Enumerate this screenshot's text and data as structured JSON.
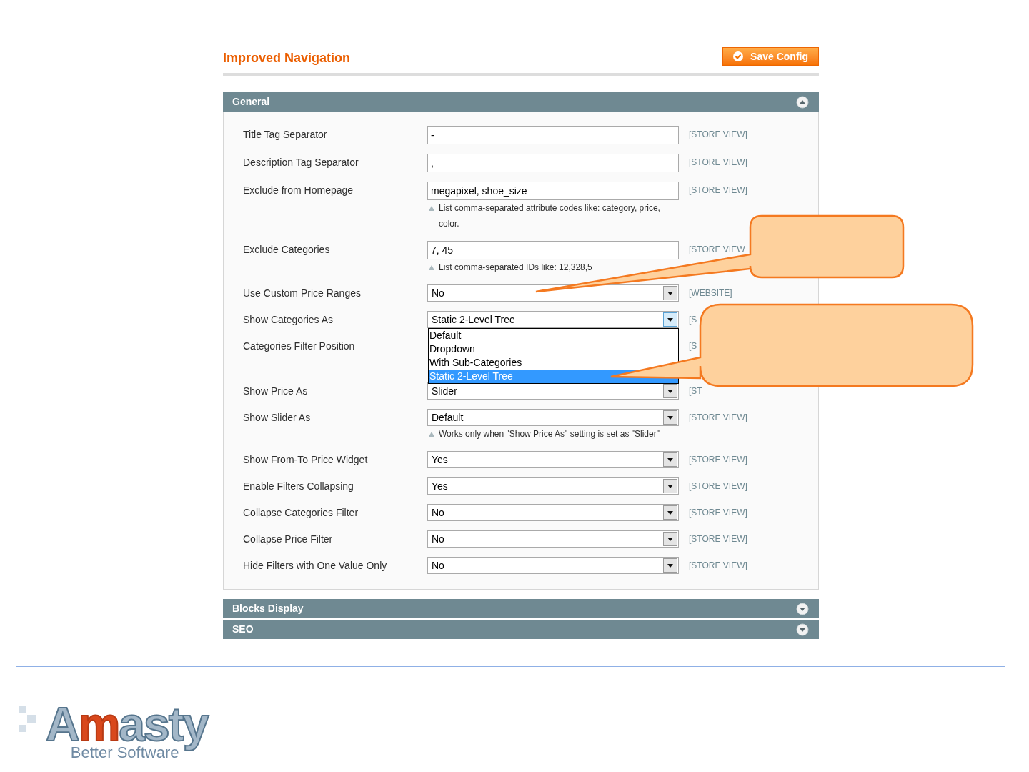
{
  "header": {
    "title": "Improved Navigation",
    "save_button": "Save Config"
  },
  "sections": [
    {
      "title": "General",
      "expanded": true,
      "rows": [
        {
          "kind": "text",
          "label": "Title Tag Separator",
          "value": "-",
          "scope": "[STORE VIEW]"
        },
        {
          "kind": "text",
          "label": "Description Tag Separator",
          "value": ",",
          "scope": "[STORE VIEW]"
        },
        {
          "kind": "text",
          "label": "Exclude from Homepage",
          "value": "megapixel, shoe_size",
          "scope": "[STORE VIEW]",
          "hint": "List comma-separated attribute codes like: category, price, color."
        },
        {
          "kind": "text",
          "label": "Exclude Categories",
          "value": "7, 45",
          "scope": "[STORE VIEW",
          "hint": "List comma-separated IDs like: 12,328,5"
        },
        {
          "kind": "select",
          "label": "Use Custom Price Ranges",
          "value": "No",
          "scope": "[WEBSITE]",
          "open": false
        },
        {
          "kind": "select",
          "label": "Show Categories As",
          "value": "Static 2-Level Tree",
          "scope": "[S",
          "open": true,
          "options": [
            {
              "label": "Default",
              "selected": false
            },
            {
              "label": "Dropdown",
              "selected": false
            },
            {
              "label": "With Sub-Categories",
              "selected": false
            },
            {
              "label": "Static 2-Level Tree",
              "selected": true
            }
          ]
        },
        {
          "kind": "covered",
          "label": "Categories Filter Position",
          "scope": "[S"
        },
        {
          "kind": "select",
          "label": "Show Price As",
          "value": "Slider",
          "scope": "[ST",
          "open": false
        },
        {
          "kind": "select",
          "label": "Show Slider As",
          "value": "Default",
          "scope": "[STORE VIEW]",
          "open": false,
          "hint": "Works only when \"Show Price As\" setting is set as \"Slider\""
        },
        {
          "kind": "select",
          "label": "Show From-To Price Widget",
          "value": "Yes",
          "scope": "[STORE VIEW]",
          "open": false
        },
        {
          "kind": "select",
          "label": "Enable Filters Collapsing",
          "value": "Yes",
          "scope": "[STORE VIEW]",
          "open": false
        },
        {
          "kind": "select",
          "label": "Collapse Categories Filter",
          "value": "No",
          "scope": "[STORE VIEW]",
          "open": false
        },
        {
          "kind": "select",
          "label": "Collapse Price Filter",
          "value": "No",
          "scope": "[STORE VIEW]",
          "open": false
        },
        {
          "kind": "select",
          "label": "Hide Filters with One Value Only",
          "value": "No",
          "scope": "[STORE VIEW]",
          "open": false
        }
      ]
    },
    {
      "title": "Blocks Display",
      "expanded": false
    },
    {
      "title": "SEO",
      "expanded": false
    }
  ],
  "logo": {
    "wordmark": [
      {
        "text": "A",
        "highlight": false
      },
      {
        "text": "m",
        "highlight": true
      },
      {
        "text": "asty",
        "highlight": false
      }
    ],
    "tagline": "Better Software"
  }
}
